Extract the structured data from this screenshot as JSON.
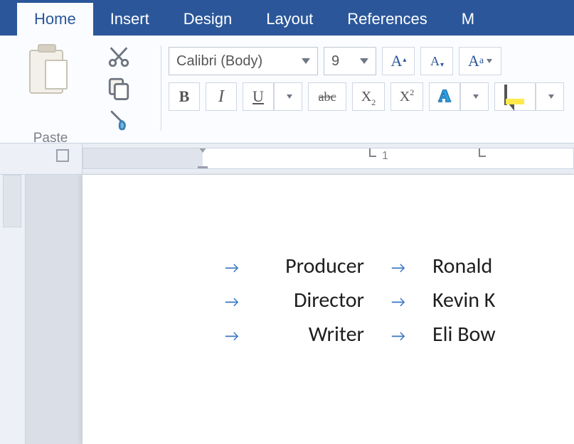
{
  "tabs": {
    "home": "Home",
    "insert": "Insert",
    "design": "Design",
    "layout": "Layout",
    "references": "References",
    "more": "M"
  },
  "ribbon": {
    "paste_label": "Paste",
    "font_name": "Calibri (Body)",
    "font_size": "9",
    "bold": "B",
    "italic": "I",
    "underline": "U",
    "strike": "abc",
    "subscript": "X",
    "superscript": "X",
    "grow": "A",
    "shrink": "A",
    "case_big": "A",
    "case_small": "a",
    "effects": "A"
  },
  "ruler": {
    "num1": "1"
  },
  "document": {
    "rows": [
      {
        "role": "Producer",
        "name": "Ronald"
      },
      {
        "role": "Director",
        "name": "Kevin K"
      },
      {
        "role": "Writer",
        "name": "Eli Bow"
      }
    ]
  },
  "glyphs": {
    "tab_arrow": "→"
  }
}
